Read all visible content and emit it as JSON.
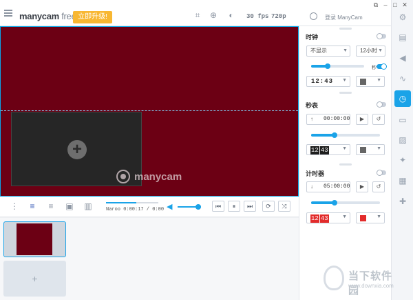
{
  "app": {
    "brand_main": "manycam",
    "brand_free": "free",
    "upgrade_label": "立即升级!",
    "fps": "30 fps",
    "resolution": "720p",
    "login": "登录 ManyCam"
  },
  "preview": {
    "watermark": "manycam"
  },
  "playlist": {
    "time": "Naroo 0:00:17 / 0:00",
    "progress": 0.58,
    "volume": 0.8
  },
  "panel": {
    "clock": {
      "title": "时钟",
      "enabled": false,
      "display_select": "不显示",
      "format_select": "12小时",
      "seconds_label": "秒",
      "seconds_enabled": true,
      "digits": "12:43",
      "color": "#666666"
    },
    "stopwatch": {
      "title": "秒表",
      "enabled": false,
      "arrow": "↑",
      "time": "00:00:00",
      "lcd_a": "12",
      "lcd_b": "43",
      "color": "#666666"
    },
    "timer": {
      "title": "计时器",
      "enabled": false,
      "arrow": "↓",
      "time": "05:00:00",
      "lcd_a": "12",
      "lcd_b": "43",
      "color": "#e22b2b"
    }
  },
  "site_watermark": {
    "title": "当下软件园",
    "url": "www.downxia.com"
  },
  "colors": {
    "accent": "#1aa3e8",
    "preview_bg": "#6c0014",
    "upgrade": "#f8b732"
  }
}
